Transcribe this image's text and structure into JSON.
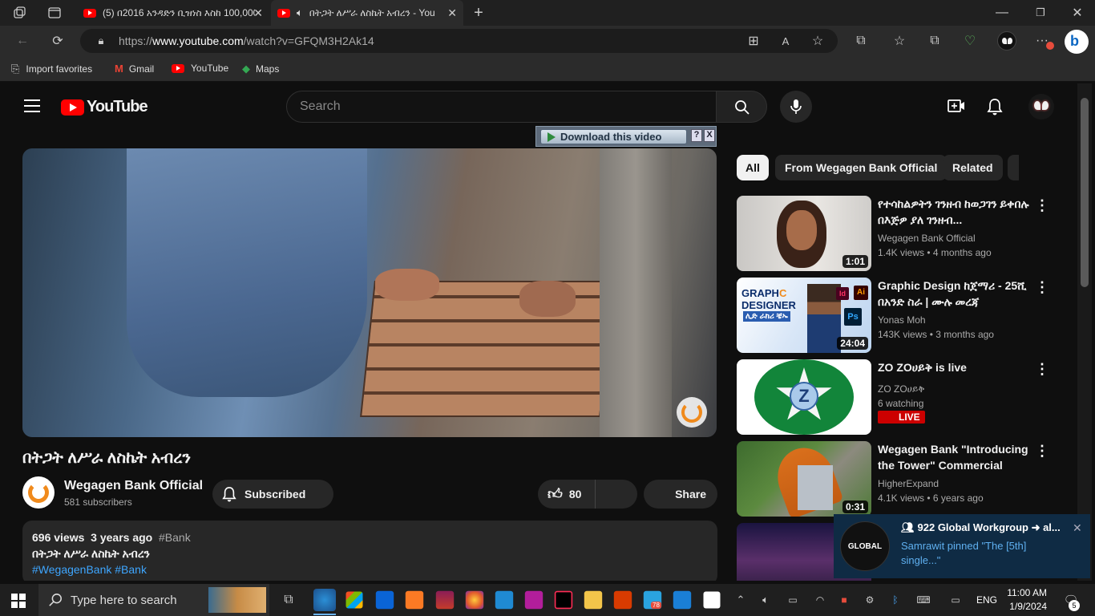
{
  "tabs": [
    {
      "label": "(5) በ2016 አንዳድን ቢዝነስ እስከ 100,000"
    },
    {
      "label": "በትጋት ለሥራ ለስኬት አብረን - You"
    }
  ],
  "address": {
    "prefix": "https://",
    "domain": "www.youtube.com",
    "path": "/watch?v=GFQM3H2Ak14"
  },
  "favorites": [
    "Import favorites",
    "Gmail",
    "YouTube",
    "Maps"
  ],
  "youtube": {
    "logo": "YouTube",
    "search_placeholder": "Search",
    "download_btn": "Download this video",
    "download_help": "?",
    "download_close": "X",
    "video_title": "በትጋት ለሥራ ለስኬት አብረን",
    "channel": "Wegagen Bank Official",
    "subscribers": "581 subscribers",
    "subscribe_label": "Subscribed",
    "likes": "80",
    "share_label": "Share",
    "views": "696 views",
    "age": "3 years ago",
    "tag": "#Bank",
    "desc_line1": "በትጋት ለሥራ ለስኬት አብረን",
    "desc_tags": "#WegagenBank #Bank",
    "chips": [
      "All",
      "From Wegagen Bank Official",
      "Related"
    ],
    "recs": [
      {
        "title": "የተሳከልዎትን ገንዘብ ከወጋገን ይቀበሉ በእጅዎ ያለ ገንዘብ...",
        "channel": "Wegagen Bank Official",
        "views": "1.4K views",
        "age": "4 months ago",
        "duration": "1:01"
      },
      {
        "title": "Graphic Design ከጀማሪ - 25ሺ በአንድ ስራ | ሙሉ መረጃ",
        "channel": "Yonas Moh",
        "views": "143K views",
        "age": "3 months ago",
        "duration": "24:04",
        "thumb_text1": "GRAPH",
        "thumb_text2": "C",
        "thumb_text3": "DESIGNER",
        "thumb_amharic": "ሊድ ራክሪ ቼኡ"
      },
      {
        "title": "ZO ZOሀይቅ is live",
        "channel": "ZO ZOሀይቅ",
        "views": "6 watching",
        "age": "",
        "duration": "",
        "live": "LIVE"
      },
      {
        "title": "Wegagen Bank \"Introducing the Tower\" Commercial",
        "channel": "HigherExpand",
        "views": "4.1K views",
        "age": "6 years ago",
        "duration": "0:31"
      }
    ],
    "notification": {
      "title": "922 Global Workgroup ➜ al...",
      "body": "Samrawit pinned \"The [5th] single...\"",
      "avatar_text": "GLOBAL"
    }
  },
  "taskbar": {
    "search_placeholder": "Type here to search",
    "lang": "ENG",
    "time": "11:00 AM",
    "date": "1/9/2024",
    "notif_count": "5",
    "tg_badge": "78"
  }
}
